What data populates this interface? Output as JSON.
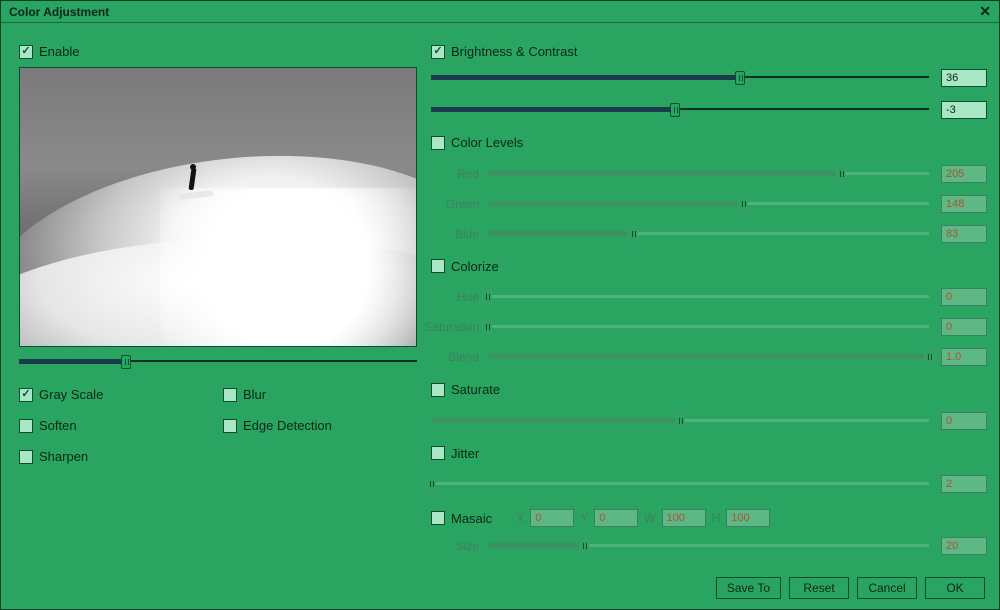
{
  "window": {
    "title": "Color Adjustment"
  },
  "left": {
    "enable_label": "Enable",
    "enable_checked": true,
    "preview_slider_pct": 27,
    "effects": {
      "gray_scale": {
        "label": "Gray Scale",
        "checked": true
      },
      "blur": {
        "label": "Blur",
        "checked": false
      },
      "soften": {
        "label": "Soften",
        "checked": false
      },
      "edge_detection": {
        "label": "Edge Detection",
        "checked": false
      },
      "sharpen": {
        "label": "Sharpen",
        "checked": false
      }
    }
  },
  "right": {
    "brightness_contrast": {
      "label": "Brightness & Contrast",
      "checked": true,
      "brightness": {
        "value": "36",
        "pct": 62
      },
      "contrast": {
        "value": "-3",
        "pct": 49
      }
    },
    "color_levels": {
      "label": "Color Levels",
      "checked": false,
      "red": {
        "label": "Red",
        "value": "205",
        "pct": 80
      },
      "green": {
        "label": "Green",
        "value": "148",
        "pct": 58
      },
      "blue": {
        "label": "Blue",
        "value": "83",
        "pct": 33
      }
    },
    "colorize": {
      "label": "Colorize",
      "checked": false,
      "hue": {
        "label": "Hue",
        "value": "0",
        "pct": 0
      },
      "saturation": {
        "label": "Saturation",
        "value": "0",
        "pct": 0
      },
      "blend": {
        "label": "Blend",
        "value": "1.0",
        "pct": 100
      }
    },
    "saturate": {
      "label": "Saturate",
      "checked": false,
      "row": {
        "value": "0",
        "pct": 50
      }
    },
    "jitter": {
      "label": "Jitter",
      "checked": false,
      "row": {
        "value": "2",
        "pct": 0
      }
    },
    "mosaic": {
      "label": "Masaic",
      "checked": false,
      "x_label": "X",
      "x": "0",
      "y_label": "Y",
      "y": "0",
      "w_label": "W",
      "w": "100",
      "h_label": "H",
      "h": "100",
      "size_label": "Size",
      "size_value": "20",
      "size_pct": 22
    }
  },
  "buttons": {
    "save_to": "Save To",
    "reset": "Reset",
    "cancel": "Cancel",
    "ok": "OK"
  }
}
